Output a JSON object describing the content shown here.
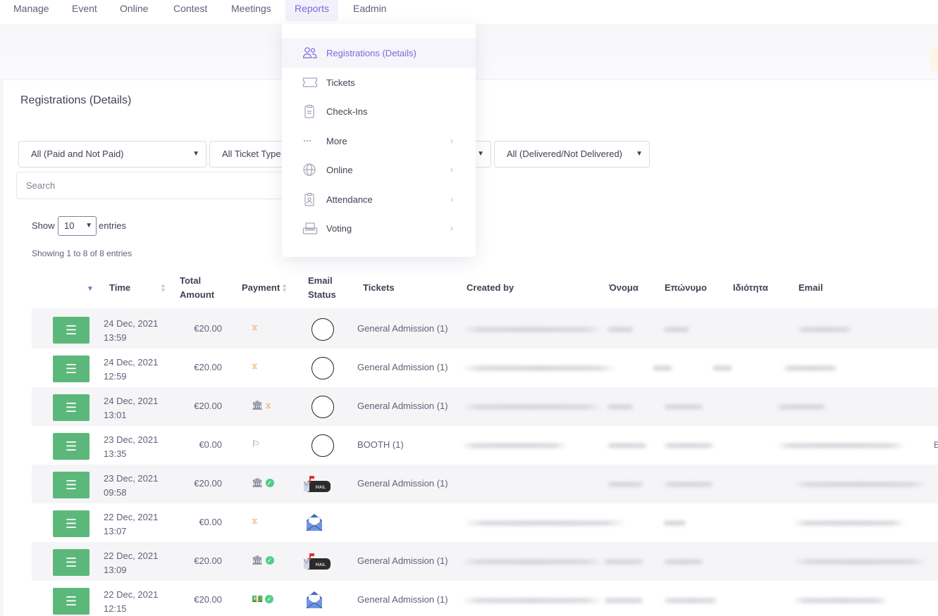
{
  "nav": {
    "tabs": [
      {
        "label": "Manage"
      },
      {
        "label": "Event"
      },
      {
        "label": "Online"
      },
      {
        "label": "Contest"
      },
      {
        "label": "Meetings"
      },
      {
        "label": "Reports",
        "active": true
      },
      {
        "label": "Eadmin"
      }
    ]
  },
  "reports_menu": {
    "items": [
      {
        "label": "Registrations (Details)",
        "icon": "users-icon",
        "active": true
      },
      {
        "label": "Tickets",
        "icon": "ticket-icon"
      },
      {
        "label": "Check-Ins",
        "icon": "clipboard-icon"
      },
      {
        "label": "More",
        "icon": "dots-icon",
        "submenu": true
      },
      {
        "label": "Online",
        "icon": "globe-icon",
        "submenu": true
      },
      {
        "label": "Attendance",
        "icon": "badge-icon",
        "submenu": true
      },
      {
        "label": "Voting",
        "icon": "ballot-icon",
        "submenu": true
      }
    ]
  },
  "page": {
    "title": "Registrations (Details)"
  },
  "filters": {
    "payment": "All (Paid and Not Paid)",
    "ticket_type": "All Ticket Type",
    "delivery": "All (Delivered/Not Delivered)",
    "search_placeholder": "Search"
  },
  "pagination": {
    "show_label": "Show",
    "page_size": "10",
    "entries_label": "entries",
    "info": "Showing 1 to 8 of 8 entries"
  },
  "table": {
    "columns": {
      "time": "Time",
      "total_amount_1": "Total",
      "total_amount_2": "Amount",
      "payment": "Payment",
      "email_status_1": "Email",
      "email_status_2": "Status",
      "tickets": "Tickets",
      "created_by": "Created by",
      "first_name": "Όνομα",
      "last_name": "Επώνυμο",
      "role": "Ιδιότητα",
      "email": "Email"
    },
    "rows": [
      {
        "date": "24 Dec, 2021",
        "time": "13:59",
        "amount": "€20.00",
        "payment": "pending",
        "email_status": "none",
        "tickets": "General Admission (1)"
      },
      {
        "date": "24 Dec, 2021",
        "time": "12:59",
        "amount": "€20.00",
        "payment": "pending",
        "email_status": "none",
        "tickets": "General Admission (1)"
      },
      {
        "date": "24 Dec, 2021",
        "time": "13:01",
        "amount": "€20.00",
        "payment": "bank-pending",
        "email_status": "none",
        "tickets": "General Admission (1)"
      },
      {
        "date": "23 Dec, 2021",
        "time": "13:35",
        "amount": "€0.00",
        "payment": "flag",
        "email_status": "none",
        "tickets": "BOOTH (1)"
      },
      {
        "date": "23 Dec, 2021",
        "time": "09:58",
        "amount": "€20.00",
        "payment": "bank-paid",
        "email_status": "mailbox",
        "tickets": "General Admission (1)"
      },
      {
        "date": "22 Dec, 2021",
        "time": "13:07",
        "amount": "€0.00",
        "payment": "pending",
        "email_status": "envelope",
        "tickets": ""
      },
      {
        "date": "22 Dec, 2021",
        "time": "13:09",
        "amount": "€20.00",
        "payment": "bank-paid",
        "email_status": "mailbox",
        "tickets": "General Admission (1)"
      },
      {
        "date": "22 Dec, 2021",
        "time": "12:15",
        "amount": "€20.00",
        "payment": "cash-paid",
        "email_status": "envelope",
        "tickets": "General Admission (1)"
      }
    ]
  },
  "edge_char": "E",
  "colors": {
    "accent": "#7e67d8",
    "action_green": "#5cb87a",
    "pending_orange": "#e8a24a",
    "paid_green": "#50cd89"
  }
}
